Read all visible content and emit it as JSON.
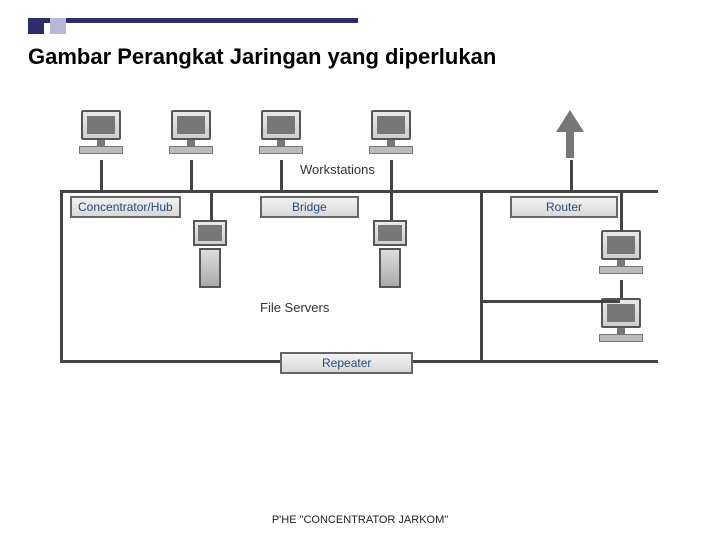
{
  "slide": {
    "title": "Gambar Perangkat Jaringan yang diperlukan",
    "footer": "P'HE \"CONCENTRATOR JARKOM\""
  },
  "labels": {
    "workstations": "Workstations",
    "file_servers": "File Servers"
  },
  "devices": {
    "hub": "Concentrator/Hub",
    "bridge": "Bridge",
    "router": "Router",
    "repeater": "Repeater"
  }
}
